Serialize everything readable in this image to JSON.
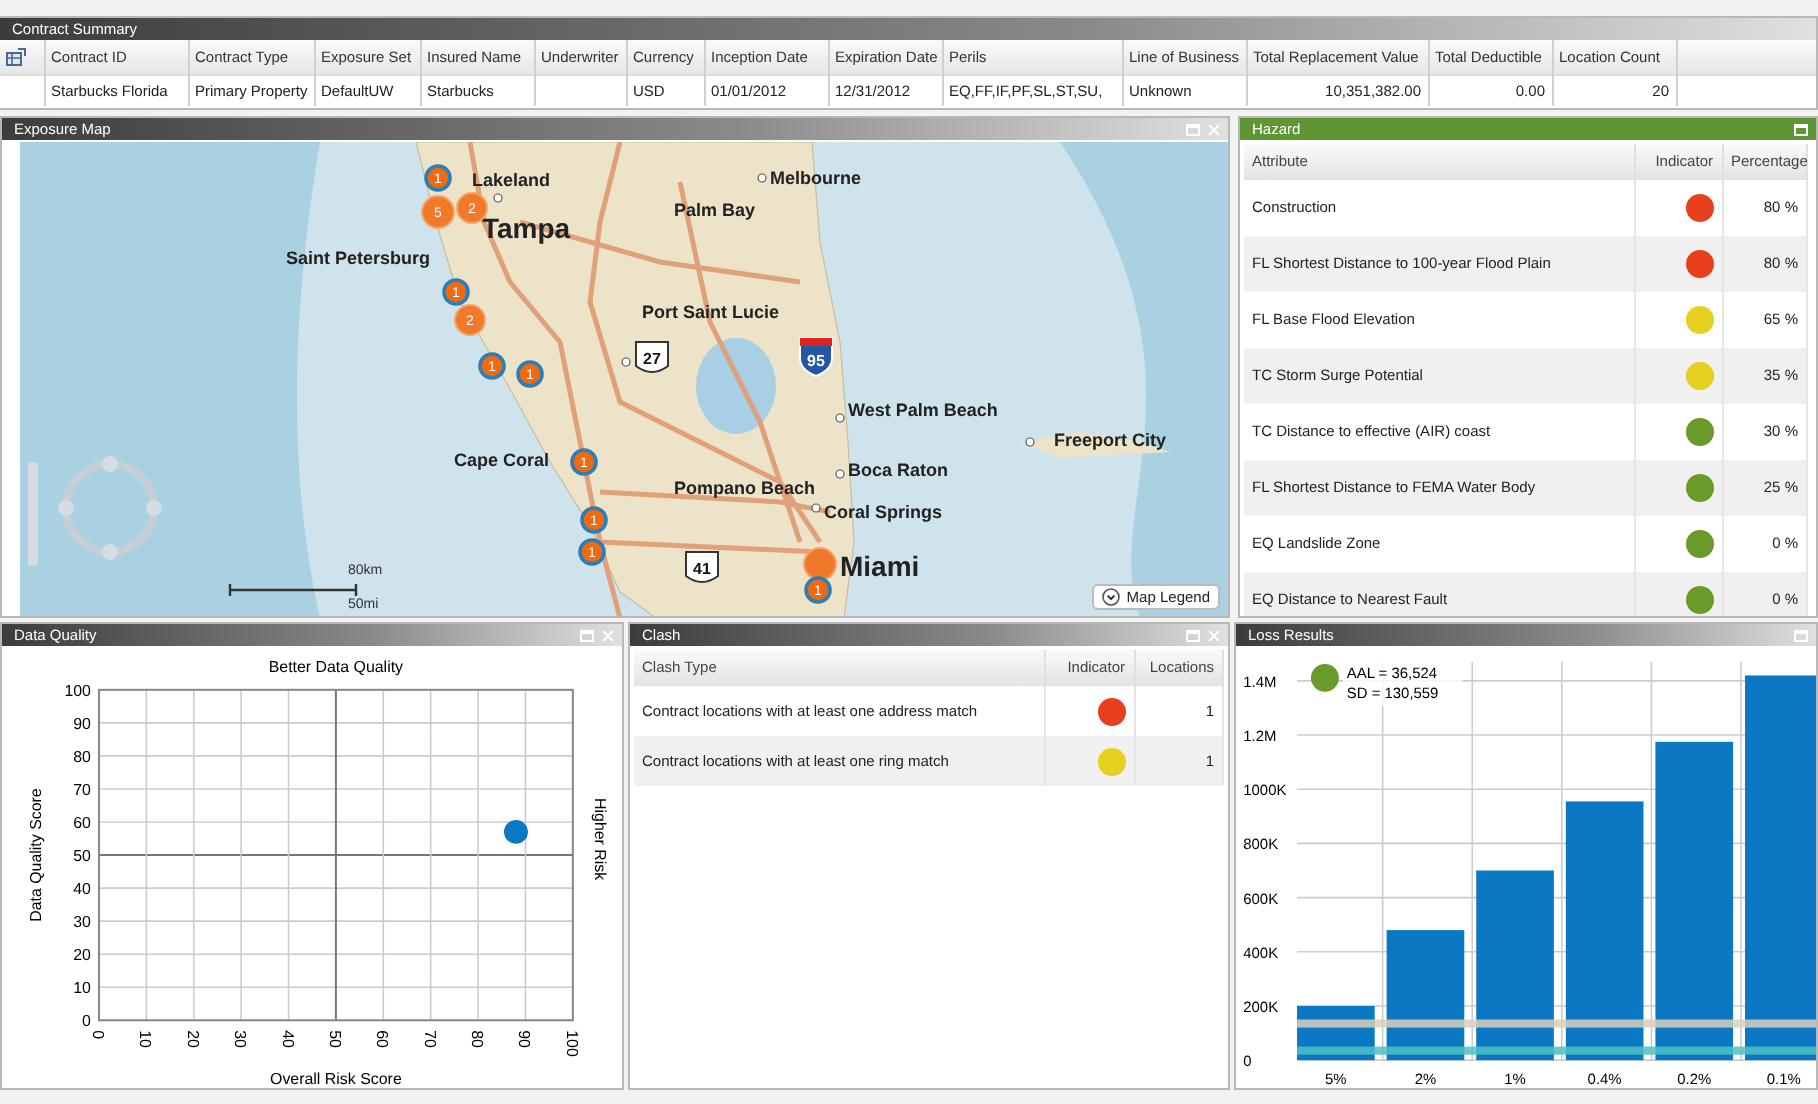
{
  "contract_summary": {
    "title": "Contract Summary",
    "columns": [
      "Contract ID",
      "Contract Type",
      "Exposure Set",
      "Insured Name",
      "Underwriter",
      "Currency",
      "Inception Date",
      "Expiration Date",
      "Perils",
      "Line of Business",
      "Total Replacement Value",
      "Total Deductible",
      "Location Count"
    ],
    "rows": [
      [
        "Starbucks Florida",
        "Primary Property",
        "DefaultUW",
        "Starbucks",
        "",
        "USD",
        "01/01/2012",
        "12/31/2012",
        "EQ,FF,IF,PF,SL,ST,SU,",
        "Unknown",
        "10,351,382.00",
        "0.00",
        "20"
      ]
    ]
  },
  "exposure_map": {
    "title": "Exposure Map",
    "closable": true,
    "cities": [
      {
        "name": "Lakeland",
        "kind": "city"
      },
      {
        "name": "Melbourne",
        "kind": "city"
      },
      {
        "name": "Palm Bay",
        "kind": "city"
      },
      {
        "name": "Tampa",
        "kind": "major"
      },
      {
        "name": "Saint Petersburg",
        "kind": "city"
      },
      {
        "name": "Port Saint Lucie",
        "kind": "city"
      },
      {
        "name": "West Palm Beach",
        "kind": "city"
      },
      {
        "name": "Freeport City",
        "kind": "city"
      },
      {
        "name": "Cape Coral",
        "kind": "city"
      },
      {
        "name": "Boca Raton",
        "kind": "city"
      },
      {
        "name": "Pompano Beach",
        "kind": "city"
      },
      {
        "name": "Coral Springs",
        "kind": "city"
      },
      {
        "name": "Miami",
        "kind": "major"
      }
    ],
    "highways": [
      {
        "number": "27",
        "kind": "us"
      },
      {
        "number": "95",
        "kind": "interstate"
      },
      {
        "number": "41",
        "kind": "us"
      }
    ],
    "markers": [
      {
        "kind": "single",
        "count": "1"
      },
      {
        "kind": "cluster",
        "count": "5"
      },
      {
        "kind": "cluster",
        "count": "2"
      },
      {
        "kind": "single",
        "count": "1"
      },
      {
        "kind": "cluster",
        "count": "2"
      },
      {
        "kind": "single",
        "count": "1"
      },
      {
        "kind": "single",
        "count": "1"
      },
      {
        "kind": "single",
        "count": "1"
      },
      {
        "kind": "single",
        "count": "1"
      },
      {
        "kind": "single",
        "count": "1"
      },
      {
        "kind": "cluster"
      },
      {
        "kind": "single",
        "count": "1"
      }
    ],
    "scale": {
      "metric": "80km",
      "imperial": "50mi"
    },
    "legend_button": "Map Legend"
  },
  "hazard": {
    "title": "Hazard",
    "closable": false,
    "columns": [
      "Attribute",
      "Indicator",
      "Percentage"
    ],
    "rows": [
      {
        "attribute": "Construction",
        "color": "#e8401c",
        "percentage": "80 %"
      },
      {
        "attribute": "FL Shortest Distance to 100-year Flood Plain",
        "color": "#e8401c",
        "percentage": "80 %"
      },
      {
        "attribute": "FL Base Flood Elevation",
        "color": "#e6cf1e",
        "percentage": "65 %"
      },
      {
        "attribute": "TC Storm Surge Potential",
        "color": "#e6cf1e",
        "percentage": "35 %"
      },
      {
        "attribute": "TC Distance to effective (AIR) coast",
        "color": "#6a9a2a",
        "percentage": "30 %"
      },
      {
        "attribute": "FL Shortest Distance to FEMA Water Body",
        "color": "#6a9a2a",
        "percentage": "25 %"
      },
      {
        "attribute": "EQ Landslide Zone",
        "color": "#6a9a2a",
        "percentage": "0 %"
      },
      {
        "attribute": "EQ Distance to Nearest Fault",
        "color": "#6a9a2a",
        "percentage": "0 %"
      }
    ]
  },
  "data_quality": {
    "title": "Data Quality",
    "closable": true,
    "chart_data": {
      "type": "scatter",
      "title": "Better Data Quality",
      "xlabel": "Overall Risk Score",
      "ylabel": "Data Quality Score",
      "x": [
        88
      ],
      "series": [
        {
          "color": "#0a78c2",
          "values": [
            57
          ]
        }
      ],
      "xlim": [
        0,
        100
      ],
      "ylim": [
        0,
        100
      ],
      "grid": true,
      "xticks": [
        0,
        10,
        20,
        30,
        40,
        50,
        60,
        70,
        80,
        90,
        100
      ],
      "yticks": [
        0,
        10,
        20,
        30,
        40,
        50,
        60,
        70,
        80,
        90,
        100
      ],
      "annotations": [
        "Higher Risk"
      ]
    }
  },
  "clash": {
    "title": "Clash",
    "closable": true,
    "columns": [
      "Clash Type",
      "Indicator",
      "Locations"
    ],
    "rows": [
      {
        "type": "Contract locations with at least one address match",
        "color": "#e8401c",
        "locations": "1"
      },
      {
        "type": "Contract locations with at least one ring match",
        "color": "#e6cf1e",
        "locations": "1"
      }
    ]
  },
  "loss_results": {
    "title": "Loss Results",
    "closable": false,
    "legend": {
      "color": "#6a9a2a",
      "aal": "AAL = 36,524",
      "sd": "SD = 130,559"
    },
    "chart_data": {
      "type": "bar",
      "grid": true,
      "bands": [
        {
          "axis": "y",
          "from": 120000,
          "to": 150000,
          "color": "#d9cfb8"
        },
        {
          "axis": "y",
          "from": 20000,
          "to": 50000,
          "color": "#4fc0c4"
        }
      ],
      "categories": [
        "5%",
        "2%",
        "1%",
        "0.4%",
        "0.2%",
        "0.1%"
      ],
      "series": [
        {
          "color": "#0a78c2",
          "values": [
            200000,
            480000,
            700000,
            955000,
            1175000,
            1420000
          ]
        }
      ],
      "ylim": [
        0,
        1470000
      ],
      "yticks": [
        {
          "value": 0,
          "label": "0"
        },
        {
          "value": 200000,
          "label": "200K"
        },
        {
          "value": 400000,
          "label": "400K"
        },
        {
          "value": 600000,
          "label": "600K"
        },
        {
          "value": 800000,
          "label": "800K"
        },
        {
          "value": 1000000,
          "label": "1000K"
        },
        {
          "value": 1200000,
          "label": "1.2M"
        },
        {
          "value": 1400000,
          "label": "1.4M"
        }
      ]
    }
  }
}
